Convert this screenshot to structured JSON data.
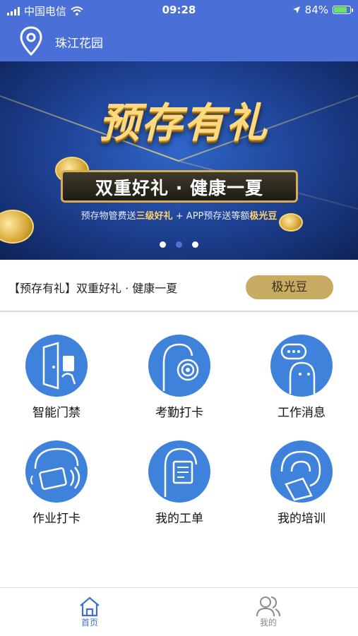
{
  "status_bar": {
    "carrier": "中国电信",
    "time": "09:28",
    "battery": "84%",
    "battery_level": 0.84
  },
  "header": {
    "location_name": "珠江花园",
    "icon": "location-pin-icon"
  },
  "banner": {
    "headline": "预存有礼",
    "subheadline": "双重好礼 · 健康一夏",
    "promo_prefix": "预存物管费送",
    "promo_highlight1": "三级好礼",
    "promo_mid": " + APP预存送等额",
    "promo_highlight2": "极光豆",
    "carousel_active_index": 1,
    "carousel_count": 3
  },
  "notice": {
    "text": "【预存有礼】双重好礼 · 健康一夏",
    "button_label": "极光豆"
  },
  "features": [
    {
      "label": "智能门禁",
      "icon": "smart-door-access-icon"
    },
    {
      "label": "考勤打卡",
      "icon": "attendance-fingerprint-icon"
    },
    {
      "label": "工作消息",
      "icon": "work-message-icon"
    },
    {
      "label": "作业打卡",
      "icon": "task-checkin-card-icon"
    },
    {
      "label": "我的工单",
      "icon": "work-order-icon"
    },
    {
      "label": "我的培训",
      "icon": "training-icon"
    }
  ],
  "tabbar": {
    "home_label": "首页",
    "mine_label": "我的",
    "active": "home"
  },
  "colors": {
    "primary": "#4a6fd6",
    "icon_circle": "#3f82dc",
    "gold_button": "#c8ab63",
    "tab_active": "#3f6fcf",
    "tab_inactive": "#8a8a8a"
  }
}
